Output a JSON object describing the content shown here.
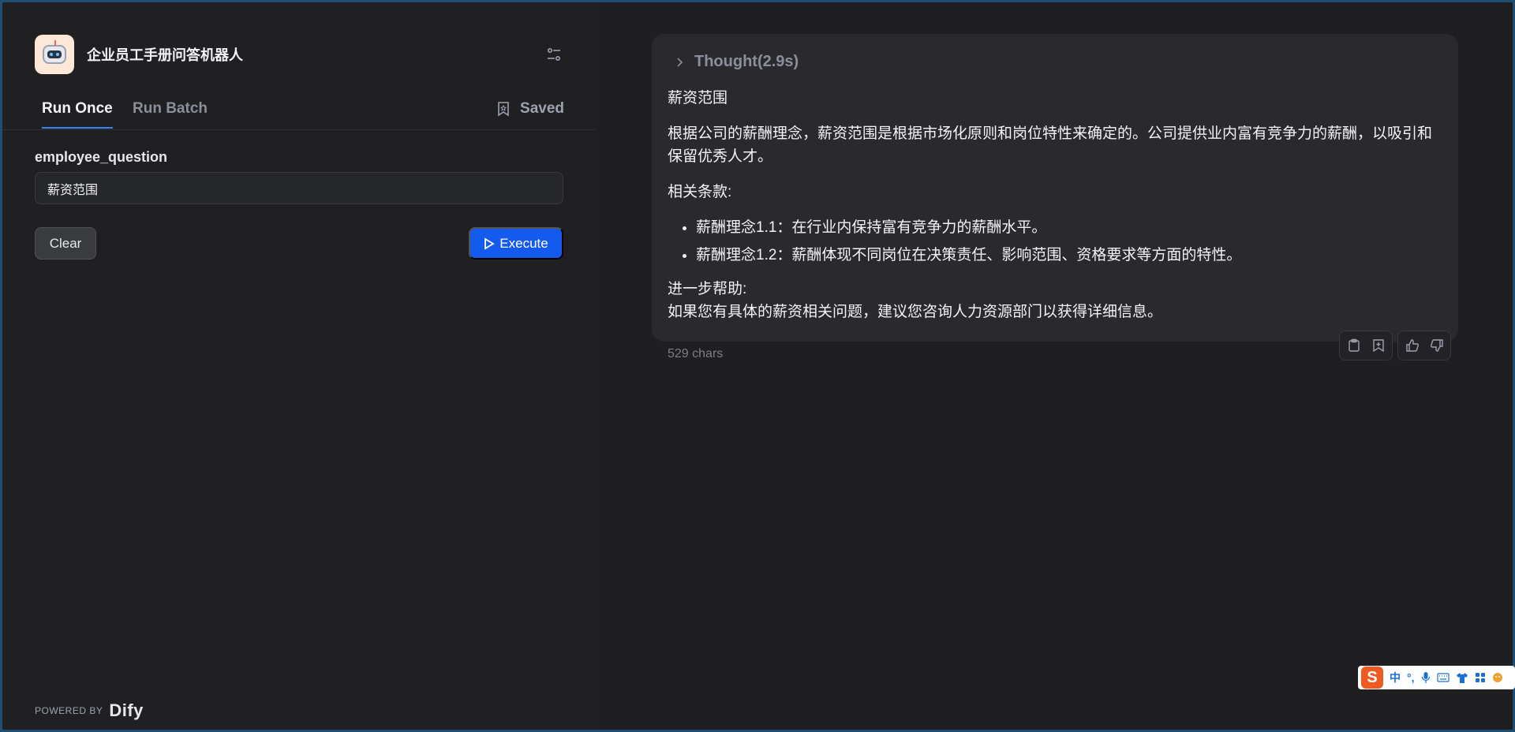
{
  "app": {
    "title": "企业员工手册问答机器人"
  },
  "tabs": [
    {
      "label": "Run Once"
    },
    {
      "label": "Run Batch"
    }
  ],
  "saved_label": "Saved",
  "form": {
    "field_label": "employee_question",
    "field_value": "薪资范围",
    "clear_label": "Clear",
    "execute_label": "Execute"
  },
  "footer": {
    "powered_by": "POWERED BY",
    "brand": "Dify"
  },
  "result": {
    "thought_label": "Thought(2.9s)",
    "heading": "薪资范围",
    "paragraph1": "根据公司的薪酬理念，薪资范围是根据市场化原则和岗位特性来确定的。公司提供业内富有竞争力的薪酬，以吸引和保留优秀人才。",
    "clauses_title": "相关条款:",
    "clauses": [
      "薪酬理念1.1：在行业内保持富有竞争力的薪酬水平。",
      "薪酬理念1.2：薪酬体现不同岗位在决策责任、影响范围、资格要求等方面的特性。"
    ],
    "help_title": "进一步帮助:",
    "help_text": "如果您有具体的薪资相关问题，建议您咨询人力资源部门以获得详细信息。",
    "char_count": "529 chars"
  },
  "ime": {
    "logo": "S",
    "lang": "中",
    "punct": "°,"
  },
  "colors": {
    "accent": "#155aef",
    "tab_underline": "#3b82f6",
    "background": "#1f1f22",
    "card": "#2a2a2e"
  }
}
